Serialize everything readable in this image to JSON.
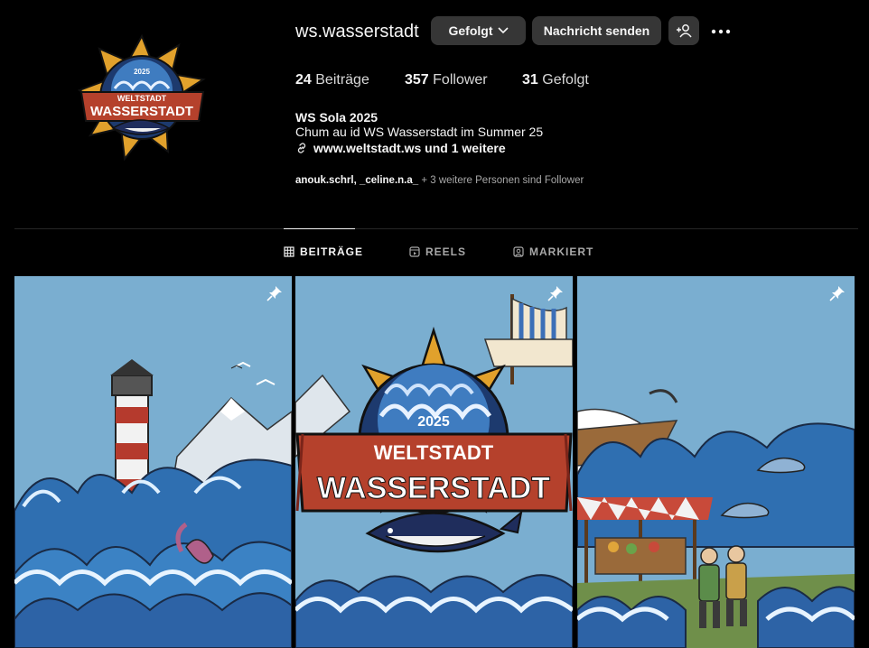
{
  "profile": {
    "username": "ws.wasserstadt",
    "buttons": {
      "follow": "Gefolgt",
      "message": "Nachricht senden"
    },
    "stats": {
      "posts": {
        "count": "24",
        "label": "Beiträge"
      },
      "followers": {
        "count": "357",
        "label": "Follower"
      },
      "following": {
        "count": "31",
        "label": "Gefolgt"
      }
    },
    "bio": {
      "name": "WS Sola 2025",
      "text": "Chum au id WS Wasserstadt im Summer 25",
      "link": "www.weltstadt.ws und 1 weitere"
    },
    "followed_by": {
      "user1": "anouk.schrl",
      "separator": ", ",
      "user2": "_celine.n.a_",
      "rest": " + 3 weitere Personen sind Follower"
    },
    "logo": {
      "year": "2025",
      "line1": "WELTSTADT",
      "line2": "WASSERSTADT"
    }
  },
  "tabs": [
    {
      "label": "BEITRÄGE",
      "icon": "grid-icon",
      "active": true
    },
    {
      "label": "REELS",
      "icon": "reels-icon",
      "active": false
    },
    {
      "label": "MARKIERT",
      "icon": "tagged-icon",
      "active": false
    }
  ],
  "posts": [
    {
      "scene": "lighthouse",
      "pinned": true
    },
    {
      "scene": "logo",
      "pinned": true,
      "year": "2025",
      "line1": "WELTSTADT",
      "line2": "WASSERSTADT"
    },
    {
      "scene": "market",
      "pinned": true
    }
  ],
  "colors": {
    "background": "#000000",
    "button": "#363636",
    "sky": "#7aaed0",
    "banner": "#b5412c",
    "ocean": "#2f6fb1"
  }
}
